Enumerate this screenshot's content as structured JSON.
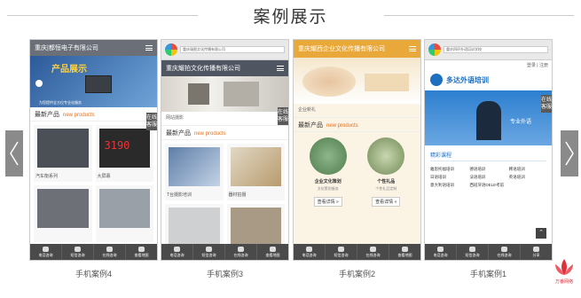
{
  "section": {
    "title": "案例展示"
  },
  "nav": {
    "prev_icon": "chevron-left-icon",
    "next_icon": "chevron-right-icon"
  },
  "cards": [
    {
      "caption": "手机案例4",
      "header_color": "#6a6f78",
      "site_name": "重庆|都恒电子有限公司",
      "banner_text": "产品展示",
      "banner_sub": "为您提供全方位专业化服务",
      "section_cn": "最新产品",
      "section_en": "new products",
      "items": [
        "汽车衡系列",
        "大屏幕",
        "",
        ""
      ],
      "side_tab": "在线客服",
      "bottom": [
        "电话咨询",
        "短信咨询",
        "在线咨询",
        "查看地图"
      ]
    },
    {
      "caption": "手机案例3",
      "url": "重庆瑞图文化传播有限公司",
      "header_color": "#4f5661",
      "site_name": "重庆耀拍文化传播有限公司",
      "banner_text": "",
      "notice": "网站摄影",
      "section_cn": "最新产品",
      "section_en": "new products",
      "items": [
        "T台摄影培训",
        "器材拍摄",
        "",
        ""
      ],
      "side_tab": "在线客服",
      "bottom": [
        "电话咨询",
        "短信咨询",
        "在线咨询",
        "查看地图"
      ]
    },
    {
      "caption": "手机案例2",
      "header_color": "#e9a93a",
      "site_name": "重庆耀西企业文化传播有限公司",
      "banner_text": "",
      "notice": "企业新礼",
      "section_cn": "最新产品",
      "section_en": "new products",
      "items": [
        "企业文化策划",
        "个性礼品"
      ],
      "item_desc": [
        "文化策划服务",
        "个性礼品定制"
      ],
      "view_btn": "查看详情 »",
      "side_tab": "",
      "bottom": [
        "电话咨询",
        "短信咨询",
        "在线咨询",
        "查看地图"
      ]
    },
    {
      "caption": "手机案例1",
      "url": "重庆四环外语培训学校",
      "header_color": "#ffffff",
      "site_name": "多达外语培训",
      "top_link": "登录 | 注册",
      "banner_text": "专业外语",
      "section_cn": "精彩课程",
      "courses": [
        "雅思托福培训",
        "德语培训",
        "韩语培训",
        "日语培训",
        "法语培训",
        "英语培训",
        "意大利语培训",
        "西班牙语DELE考前"
      ],
      "side_tab": "在线客服",
      "bottom": [
        "电话咨询",
        "短信咨询",
        "在线咨询",
        "分享"
      ]
    }
  ],
  "brand": {
    "name": "万番网络",
    "sub": "WANFAN"
  }
}
